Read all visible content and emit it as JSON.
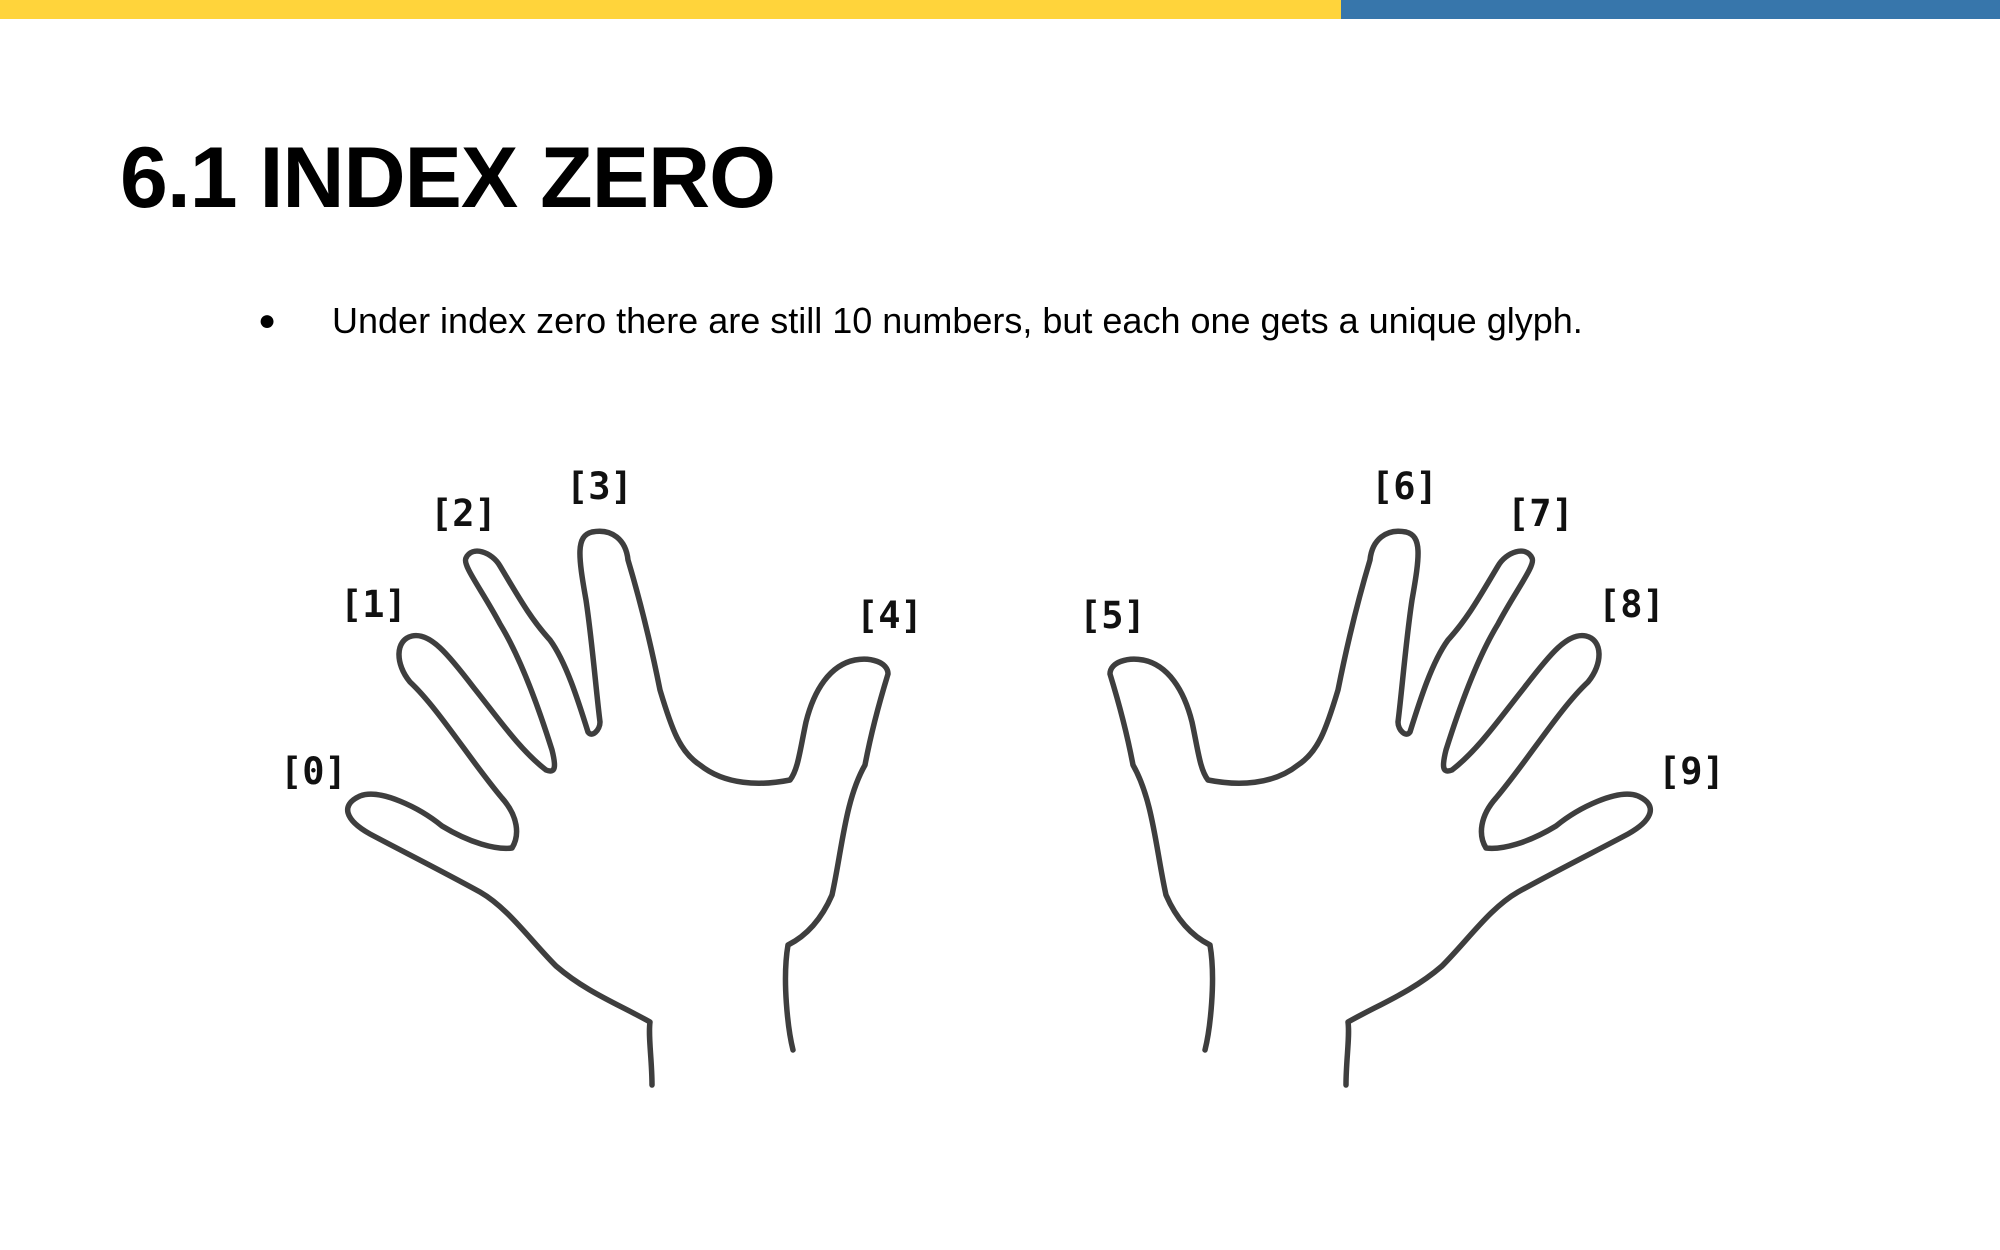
{
  "slide": {
    "title": "6.1 INDEX ZERO",
    "bullets": [
      "Under index zero there are still 10 numbers, but each one gets a unique glyph."
    ]
  },
  "figure": {
    "finger_labels": [
      "[0]",
      "[1]",
      "[2]",
      "[3]",
      "[4]",
      "[5]",
      "[6]",
      "[7]",
      "[8]",
      "[9]"
    ]
  },
  "colors": {
    "accent_yellow": "#FFD43B",
    "accent_blue": "#3776AB",
    "outline": "#3e3e3e"
  }
}
